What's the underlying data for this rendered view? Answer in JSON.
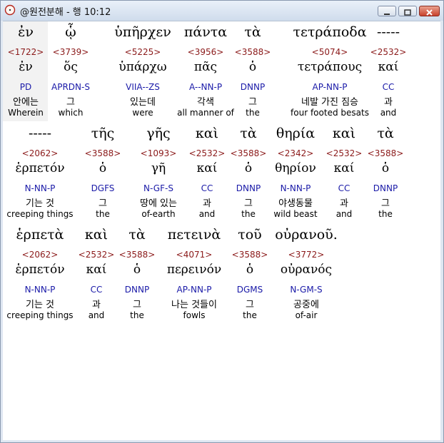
{
  "window": {
    "title": "@원전분해 - 행 10:12",
    "icon": "compass-icon",
    "buttons": [
      "minimize",
      "maximize",
      "close"
    ]
  },
  "rows": [
    [
      {
        "greek": "ἐν",
        "strong": "<1722>",
        "lemma": "ἐν",
        "parse": "PD",
        "korean": "안에는",
        "english": "Wherein"
      },
      {
        "greek": "ᾧ",
        "strong": "<3739>",
        "lemma": "ὅς",
        "parse": "APRDN-S",
        "korean": "그",
        "english": "which"
      },
      {
        "greek": "ὑπῆρχεν",
        "strong": "<5225>",
        "lemma": "ὑπάρχω",
        "parse": "VIIA--ZS",
        "korean": "있는데",
        "english": "were"
      },
      {
        "greek": "πάντα",
        "strong": "<3956>",
        "lemma": "πᾶς",
        "parse": "A--NN-P",
        "korean": "각색",
        "english": "all manner of"
      },
      {
        "greek": "τὰ",
        "strong": "<3588>",
        "lemma": "ὁ",
        "parse": "DNNP",
        "korean": "그",
        "english": "the"
      },
      {
        "greek": "τετράποδα",
        "strong": "<5074>",
        "lemma": "τετράπους",
        "parse": "AP-NN-P",
        "korean": "네발 가진 짐승",
        "english": "four footed besats"
      },
      {
        "greek": "-----",
        "strong": "<2532>",
        "lemma": "καί",
        "parse": "CC",
        "korean": "과",
        "english": "and"
      }
    ],
    [
      {
        "greek": "-----",
        "strong": "<2062>",
        "lemma": "ἑρπετόν",
        "parse": "N-NN-P",
        "korean": "기는 것",
        "english": "creeping things"
      },
      {
        "greek": "τῆς",
        "strong": "<3588>",
        "lemma": "ὁ",
        "parse": "DGFS",
        "korean": "그",
        "english": "the"
      },
      {
        "greek": "γῆς",
        "strong": "<1093>",
        "lemma": "γῆ",
        "parse": "N-GF-S",
        "korean": "땅에 있는",
        "english": "of-earth"
      },
      {
        "greek": "καὶ",
        "strong": "<2532>",
        "lemma": "καί",
        "parse": "CC",
        "korean": "과",
        "english": "and"
      },
      {
        "greek": "τὰ",
        "strong": "<3588>",
        "lemma": "ὁ",
        "parse": "DNNP",
        "korean": "그",
        "english": "the"
      },
      {
        "greek": "θηρία",
        "strong": "<2342>",
        "lemma": "θηρίον",
        "parse": "N-NN-P",
        "korean": "야생동물",
        "english": "wild beast"
      },
      {
        "greek": "καὶ",
        "strong": "<2532>",
        "lemma": "καί",
        "parse": "CC",
        "korean": "과",
        "english": "and"
      },
      {
        "greek": "τὰ",
        "strong": "<3588>",
        "lemma": "ὁ",
        "parse": "DNNP",
        "korean": "그",
        "english": "the"
      }
    ],
    [
      {
        "greek": "ἑρπετὰ",
        "strong": "<2062>",
        "lemma": "ἑρπετόν",
        "parse": "N-NN-P",
        "korean": "기는 것",
        "english": "creeping things"
      },
      {
        "greek": "καὶ",
        "strong": "<2532>",
        "lemma": "καί",
        "parse": "CC",
        "korean": "과",
        "english": "and"
      },
      {
        "greek": "τὰ",
        "strong": "<3588>",
        "lemma": "ὁ",
        "parse": "DNNP",
        "korean": "그",
        "english": "the"
      },
      {
        "greek": "πετεινὰ",
        "strong": "<4071>",
        "lemma": "περεινόν",
        "parse": "AP-NN-P",
        "korean": "나는 것들이",
        "english": "fowls"
      },
      {
        "greek": "τοῦ",
        "strong": "<3588>",
        "lemma": "ὁ",
        "parse": "DGMS",
        "korean": "그",
        "english": "the"
      },
      {
        "greek": "οὐρανοῦ.",
        "strong": "<3772>",
        "lemma": "οὐρανός",
        "parse": "N-GM-S",
        "korean": "공중에",
        "english": "of-air"
      }
    ]
  ]
}
